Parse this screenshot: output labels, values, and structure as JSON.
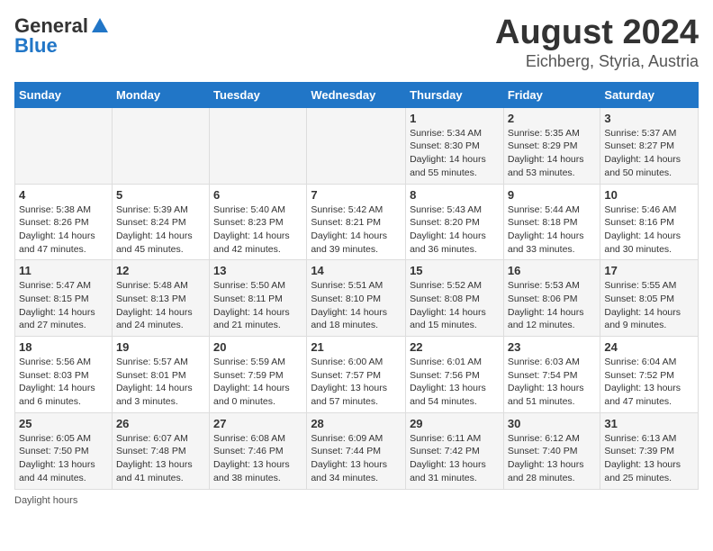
{
  "header": {
    "logo_general": "General",
    "logo_blue": "Blue",
    "title": "August 2024",
    "subtitle": "Eichberg, Styria, Austria"
  },
  "days_of_week": [
    "Sunday",
    "Monday",
    "Tuesday",
    "Wednesday",
    "Thursday",
    "Friday",
    "Saturday"
  ],
  "weeks": [
    [
      {
        "day": "",
        "info": ""
      },
      {
        "day": "",
        "info": ""
      },
      {
        "day": "",
        "info": ""
      },
      {
        "day": "",
        "info": ""
      },
      {
        "day": "1",
        "info": "Sunrise: 5:34 AM\nSunset: 8:30 PM\nDaylight: 14 hours and 55 minutes."
      },
      {
        "day": "2",
        "info": "Sunrise: 5:35 AM\nSunset: 8:29 PM\nDaylight: 14 hours and 53 minutes."
      },
      {
        "day": "3",
        "info": "Sunrise: 5:37 AM\nSunset: 8:27 PM\nDaylight: 14 hours and 50 minutes."
      }
    ],
    [
      {
        "day": "4",
        "info": "Sunrise: 5:38 AM\nSunset: 8:26 PM\nDaylight: 14 hours and 47 minutes."
      },
      {
        "day": "5",
        "info": "Sunrise: 5:39 AM\nSunset: 8:24 PM\nDaylight: 14 hours and 45 minutes."
      },
      {
        "day": "6",
        "info": "Sunrise: 5:40 AM\nSunset: 8:23 PM\nDaylight: 14 hours and 42 minutes."
      },
      {
        "day": "7",
        "info": "Sunrise: 5:42 AM\nSunset: 8:21 PM\nDaylight: 14 hours and 39 minutes."
      },
      {
        "day": "8",
        "info": "Sunrise: 5:43 AM\nSunset: 8:20 PM\nDaylight: 14 hours and 36 minutes."
      },
      {
        "day": "9",
        "info": "Sunrise: 5:44 AM\nSunset: 8:18 PM\nDaylight: 14 hours and 33 minutes."
      },
      {
        "day": "10",
        "info": "Sunrise: 5:46 AM\nSunset: 8:16 PM\nDaylight: 14 hours and 30 minutes."
      }
    ],
    [
      {
        "day": "11",
        "info": "Sunrise: 5:47 AM\nSunset: 8:15 PM\nDaylight: 14 hours and 27 minutes."
      },
      {
        "day": "12",
        "info": "Sunrise: 5:48 AM\nSunset: 8:13 PM\nDaylight: 14 hours and 24 minutes."
      },
      {
        "day": "13",
        "info": "Sunrise: 5:50 AM\nSunset: 8:11 PM\nDaylight: 14 hours and 21 minutes."
      },
      {
        "day": "14",
        "info": "Sunrise: 5:51 AM\nSunset: 8:10 PM\nDaylight: 14 hours and 18 minutes."
      },
      {
        "day": "15",
        "info": "Sunrise: 5:52 AM\nSunset: 8:08 PM\nDaylight: 14 hours and 15 minutes."
      },
      {
        "day": "16",
        "info": "Sunrise: 5:53 AM\nSunset: 8:06 PM\nDaylight: 14 hours and 12 minutes."
      },
      {
        "day": "17",
        "info": "Sunrise: 5:55 AM\nSunset: 8:05 PM\nDaylight: 14 hours and 9 minutes."
      }
    ],
    [
      {
        "day": "18",
        "info": "Sunrise: 5:56 AM\nSunset: 8:03 PM\nDaylight: 14 hours and 6 minutes."
      },
      {
        "day": "19",
        "info": "Sunrise: 5:57 AM\nSunset: 8:01 PM\nDaylight: 14 hours and 3 minutes."
      },
      {
        "day": "20",
        "info": "Sunrise: 5:59 AM\nSunset: 7:59 PM\nDaylight: 14 hours and 0 minutes."
      },
      {
        "day": "21",
        "info": "Sunrise: 6:00 AM\nSunset: 7:57 PM\nDaylight: 13 hours and 57 minutes."
      },
      {
        "day": "22",
        "info": "Sunrise: 6:01 AM\nSunset: 7:56 PM\nDaylight: 13 hours and 54 minutes."
      },
      {
        "day": "23",
        "info": "Sunrise: 6:03 AM\nSunset: 7:54 PM\nDaylight: 13 hours and 51 minutes."
      },
      {
        "day": "24",
        "info": "Sunrise: 6:04 AM\nSunset: 7:52 PM\nDaylight: 13 hours and 47 minutes."
      }
    ],
    [
      {
        "day": "25",
        "info": "Sunrise: 6:05 AM\nSunset: 7:50 PM\nDaylight: 13 hours and 44 minutes."
      },
      {
        "day": "26",
        "info": "Sunrise: 6:07 AM\nSunset: 7:48 PM\nDaylight: 13 hours and 41 minutes."
      },
      {
        "day": "27",
        "info": "Sunrise: 6:08 AM\nSunset: 7:46 PM\nDaylight: 13 hours and 38 minutes."
      },
      {
        "day": "28",
        "info": "Sunrise: 6:09 AM\nSunset: 7:44 PM\nDaylight: 13 hours and 34 minutes."
      },
      {
        "day": "29",
        "info": "Sunrise: 6:11 AM\nSunset: 7:42 PM\nDaylight: 13 hours and 31 minutes."
      },
      {
        "day": "30",
        "info": "Sunrise: 6:12 AM\nSunset: 7:40 PM\nDaylight: 13 hours and 28 minutes."
      },
      {
        "day": "31",
        "info": "Sunrise: 6:13 AM\nSunset: 7:39 PM\nDaylight: 13 hours and 25 minutes."
      }
    ]
  ],
  "footnote": "Daylight hours"
}
